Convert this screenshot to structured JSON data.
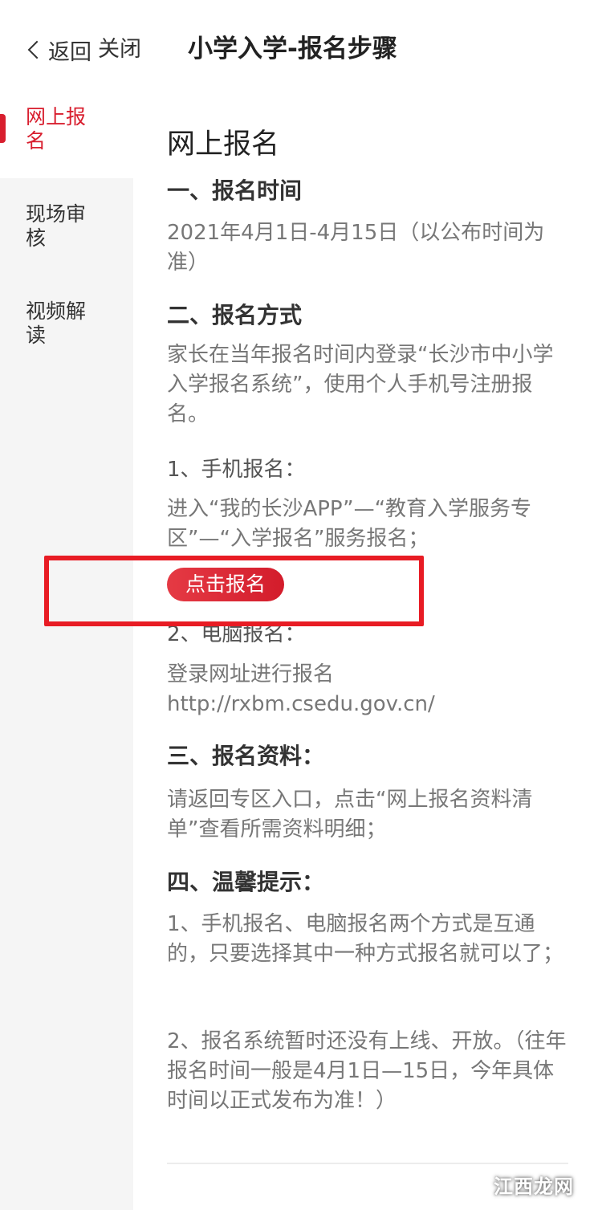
{
  "header": {
    "back_label": "返回",
    "close_label": "关闭",
    "title": "小学入学-报名步骤"
  },
  "sidebar": {
    "items": [
      {
        "label": "网上报名",
        "active": true
      },
      {
        "label": "现场审核",
        "active": false
      },
      {
        "label": "视频解读",
        "active": false
      }
    ]
  },
  "colors": {
    "accent": "#d81e2e",
    "highlight_box": "#e81c24"
  },
  "main": {
    "heading": "网上报名",
    "section1": {
      "title": "一、报名时间",
      "body": "2021年4月1日-4月15日（以公布时间为准）"
    },
    "section2": {
      "title": "二、报名方式",
      "body": "家长在当年报名时间内登录“长沙市中小学入学报名系统”，使用个人手机号注册报名。",
      "mobile": {
        "title": "1、手机报名：",
        "body": "进入“我的长沙APP”—“教育入学服务专区”—“入学报名”服务报名；",
        "button_label": "点击报名"
      },
      "pc": {
        "title": "2、电脑报名：",
        "body": "登录网址进行报名 http://rxbm.csedu.gov.cn/"
      }
    },
    "section3": {
      "title": "三、报名资料：",
      "body": "请返回专区入口，点击“网上报名资料清单”查看所需资料明细；"
    },
    "section4": {
      "title": "四、温馨提示：",
      "tip1": "1、手机报名、电脑报名两个方式是互通的，只要选择其中一种方式报名就可以了；",
      "tip2": "2、报名系统暂时还没有上线、开放。（往年报名时间一般是4月1日—15日，今年具体时间以正式发布为准！）"
    }
  },
  "watermark": "江西龙网"
}
